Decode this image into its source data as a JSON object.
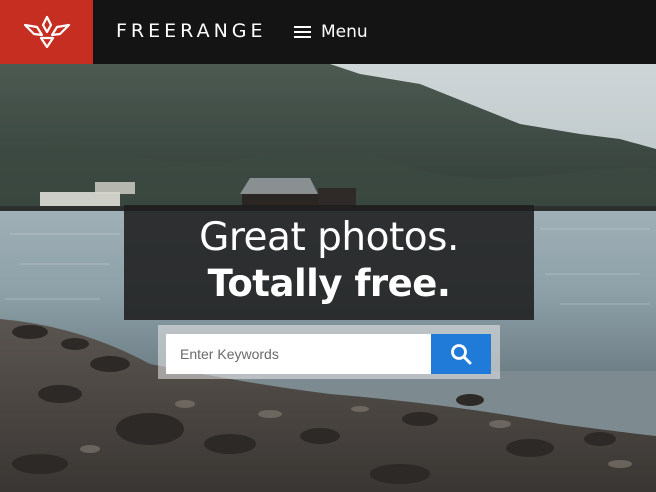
{
  "header": {
    "brand": "FREERANGE",
    "menu_label": "Menu",
    "colors": {
      "bar": "#141414",
      "logo_bg": "#c52e21"
    },
    "logo_icon": "bird-logo-icon",
    "menu_icon": "hamburger-icon"
  },
  "hero": {
    "headline_line1": "Great photos.",
    "headline_line2": "Totally free.",
    "search": {
      "placeholder": "Enter Keywords",
      "value": "",
      "button_icon": "search-icon",
      "button_color": "#1f7ad8"
    },
    "background": "lakeshore-photo"
  }
}
